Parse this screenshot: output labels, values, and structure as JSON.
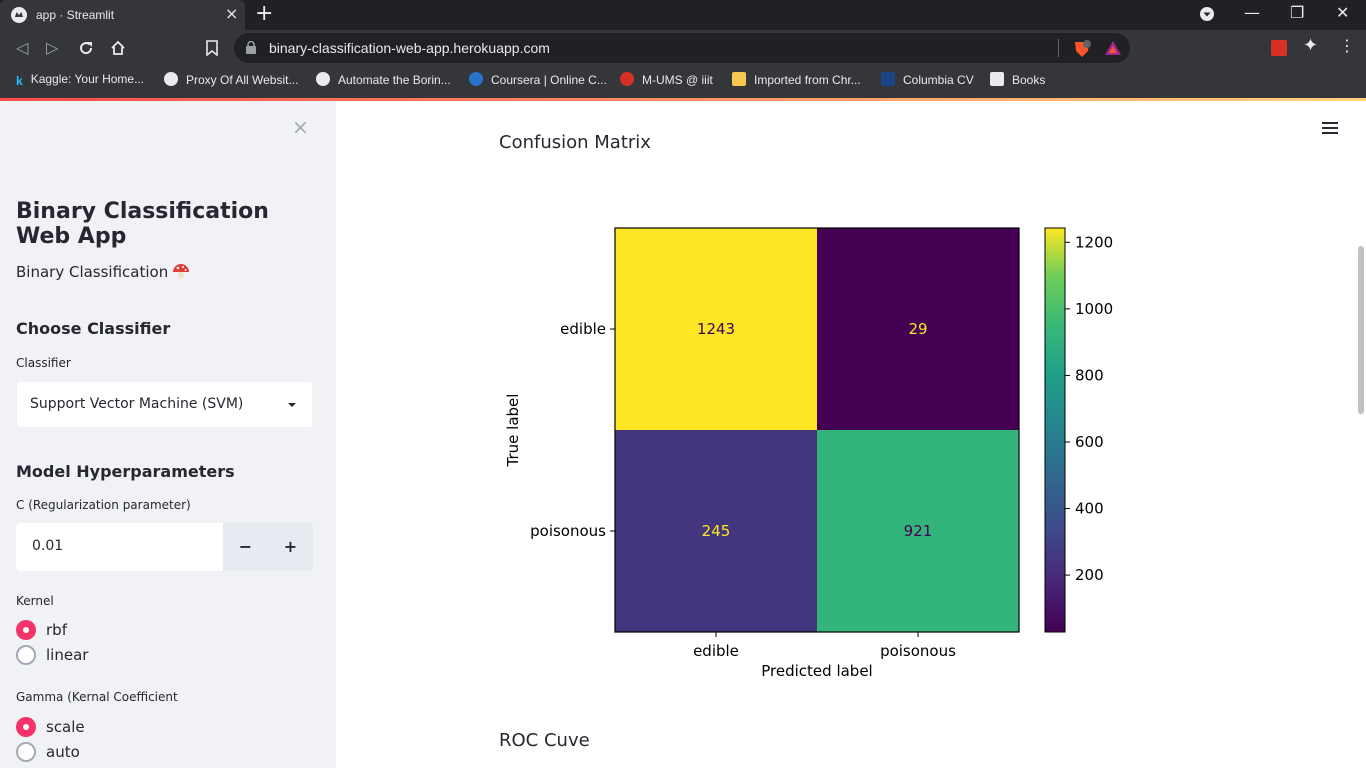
{
  "browser": {
    "tab_title": "app · Streamlit",
    "url": "binary-classification-web-app.herokuapp.com",
    "bookmarks": [
      {
        "label": "Kaggle: Your Home...",
        "color": "#20beff"
      },
      {
        "label": "Proxy Of All Websit...",
        "color": "#e8eaed"
      },
      {
        "label": "Automate the Borin...",
        "color": "#e8eaed"
      },
      {
        "label": "Coursera | Online C...",
        "color": "#2a73cc"
      },
      {
        "label": "M-UMS @ iiit",
        "color": "#d93025"
      },
      {
        "label": "Imported from Chr...",
        "color": "#f9c74f"
      },
      {
        "label": "Columbia CV",
        "color": "#1c4587"
      },
      {
        "label": "Books",
        "color": "#e8eaed"
      }
    ],
    "icons": [
      "back-icon",
      "forward-icon",
      "reload-icon",
      "home-icon",
      "bookmark-icon",
      "lock-icon",
      "brave-shield-icon",
      "extensions-icon",
      "menu-icon"
    ]
  },
  "sidebar": {
    "close_icon": "×",
    "title": "Binary Classification Web App",
    "subtitle": "Binary Classification",
    "choose_heading": "Choose Classifier",
    "classifier_label": "Classifier",
    "classifier_value": "Support Vector Machine (SVM)",
    "hyper_heading": "Model Hyperparameters",
    "c_label": "C (Regularization parameter)",
    "c_value": "0.01",
    "minus": "−",
    "plus": "+",
    "kernel_label": "Kernel",
    "kernel_options": [
      "rbf",
      "linear"
    ],
    "kernel_selected": "rbf",
    "gamma_label": "Gamma (Kernal Coefficient",
    "gamma_options": [
      "scale",
      "auto"
    ],
    "gamma_selected": "scale"
  },
  "main": {
    "confusion_heading": "Confusion Matrix",
    "roc_heading": "ROC Cuve"
  },
  "chart_data": {
    "type": "heatmap",
    "title": "",
    "xlabel": "Predicted label",
    "ylabel": "True label",
    "x_categories": [
      "edible",
      "poisonous"
    ],
    "y_categories": [
      "edible",
      "poisonous"
    ],
    "values": [
      [
        1243,
        29
      ],
      [
        245,
        921
      ]
    ],
    "colormap": "viridis",
    "colorbar_ticks": [
      200,
      400,
      600,
      800,
      1000,
      1200
    ],
    "colorbar_range": [
      29,
      1243
    ]
  }
}
